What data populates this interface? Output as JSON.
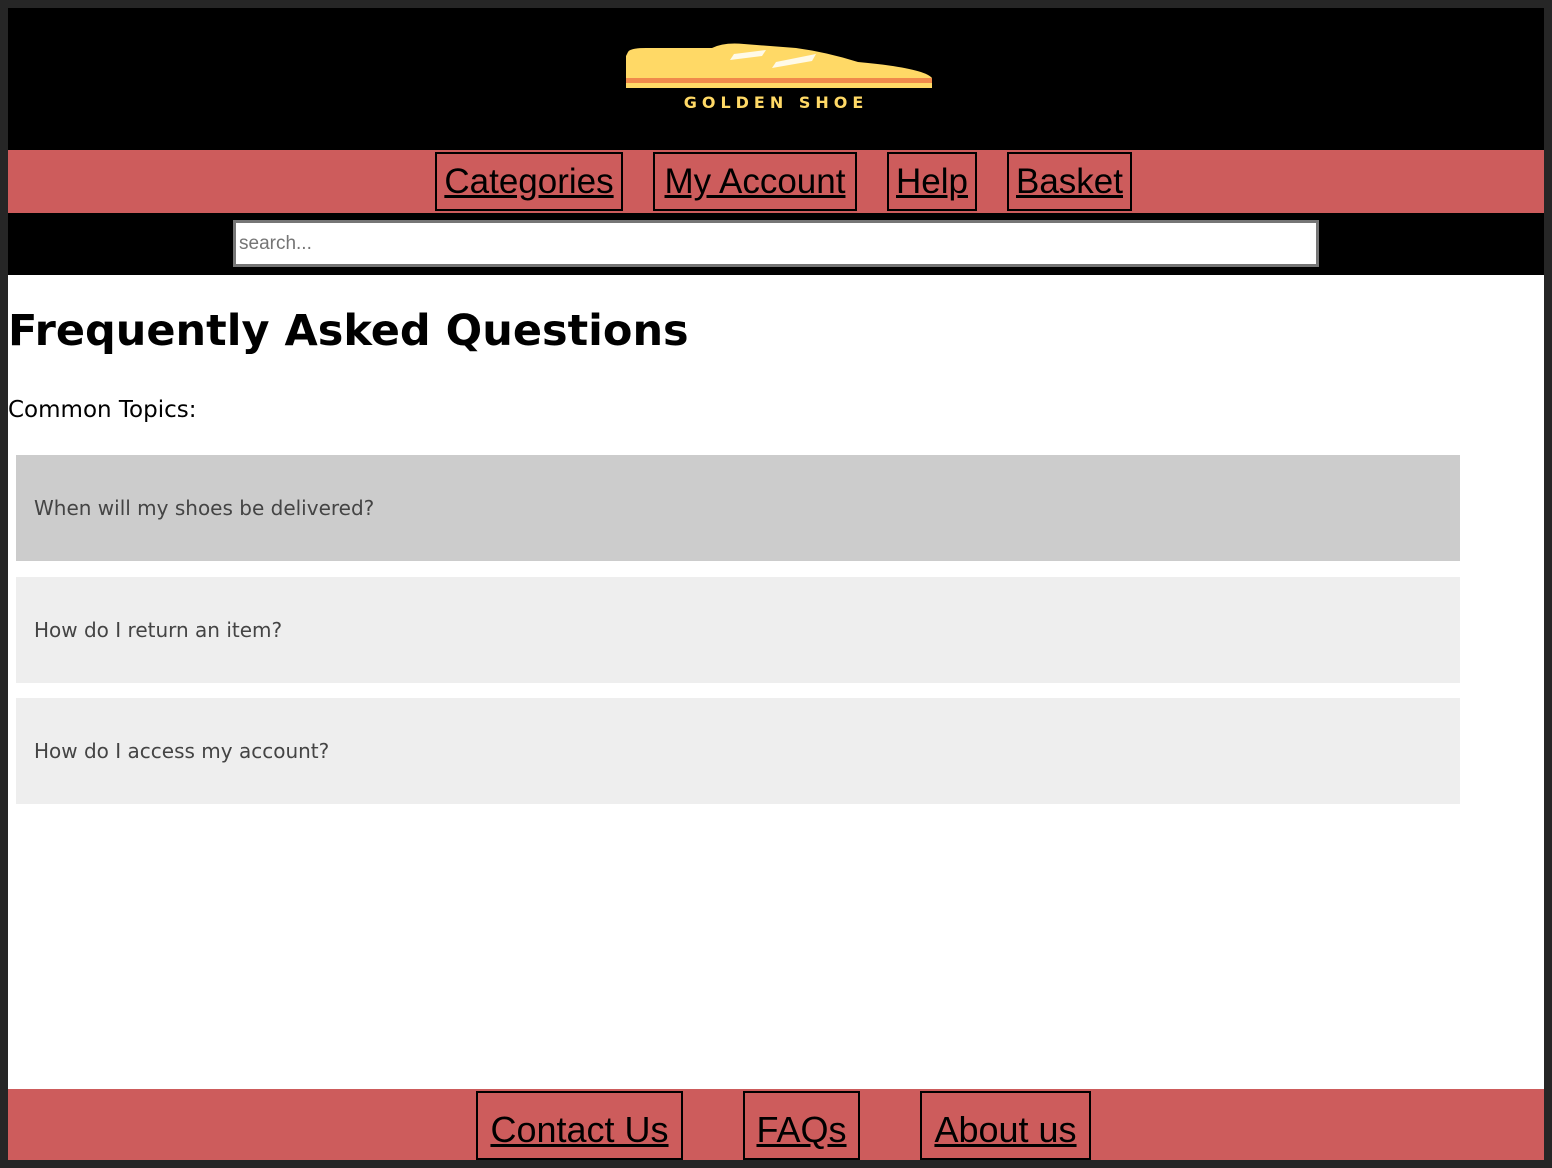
{
  "header": {
    "logo_text": "GOLDEN SHOE",
    "logo_colors": {
      "shoe": "#ffd966",
      "stripe": "#f08a4b",
      "accent": "#ffffff"
    },
    "background": "#000000"
  },
  "nav": {
    "background": "#cd5c5c",
    "items": [
      {
        "label": "Categories"
      },
      {
        "label": "My Account"
      },
      {
        "label": "Help"
      },
      {
        "label": "Basket"
      }
    ]
  },
  "search": {
    "placeholder": "search...",
    "value": ""
  },
  "main": {
    "title": "Frequently Asked Questions",
    "topics_label": "Common Topics:",
    "faqs": [
      {
        "question": "When will my shoes be delivered?",
        "active": true
      },
      {
        "question": "How do I return an item?",
        "active": false
      },
      {
        "question": "How do I access my account?",
        "active": false
      }
    ]
  },
  "footer": {
    "background": "#cd5c5c",
    "items": [
      {
        "label": "Contact Us"
      },
      {
        "label": "FAQs"
      },
      {
        "label": "About us"
      }
    ]
  }
}
